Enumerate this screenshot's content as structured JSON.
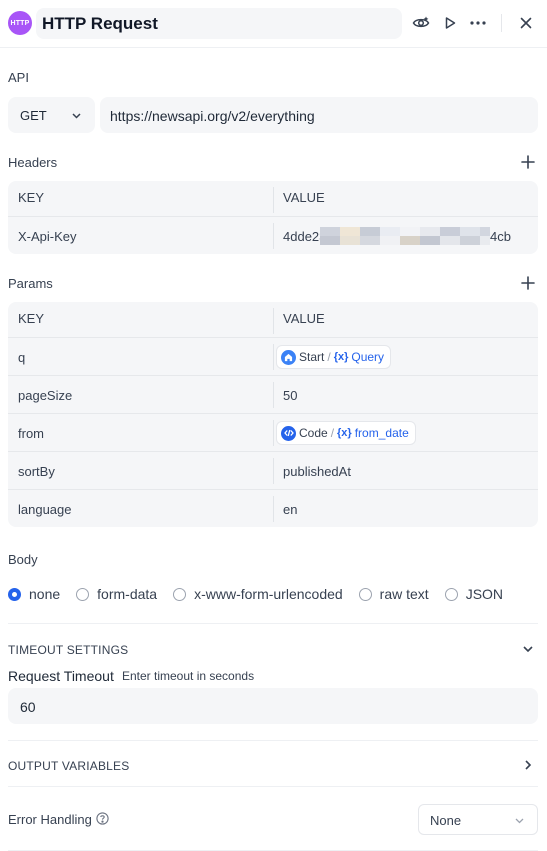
{
  "header": {
    "icon_text": "HTTP",
    "title": "HTTP Request",
    "icon_color": "#a855f7"
  },
  "api": {
    "label": "API",
    "method": "GET",
    "url": "https://newsapi.org/v2/everything"
  },
  "headers": {
    "label": "Headers",
    "columns": {
      "key": "KEY",
      "value": "VALUE"
    },
    "rows": [
      {
        "key": "X-Api-Key",
        "value_prefix": "4dde23",
        "value_suffix": "4cb"
      }
    ]
  },
  "params": {
    "label": "Params",
    "columns": {
      "key": "KEY",
      "value": "VALUE"
    },
    "rows": [
      {
        "key": "q",
        "chip": {
          "node": "Start",
          "separator": "/",
          "var_symbol": "{x}",
          "var": "Query"
        }
      },
      {
        "key": "pageSize",
        "value": "50"
      },
      {
        "key": "from",
        "chip": {
          "node": "Code",
          "separator": "/",
          "var_symbol": "{x}",
          "var": "from_date"
        }
      },
      {
        "key": "sortBy",
        "value": "publishedAt"
      },
      {
        "key": "language",
        "value": "en"
      }
    ]
  },
  "body": {
    "label": "Body",
    "options": [
      "none",
      "form-data",
      "x-www-form-urlencoded",
      "raw text",
      "JSON"
    ],
    "selected": "none"
  },
  "timeout": {
    "section_label": "TIMEOUT SETTINGS",
    "field_label": "Request Timeout",
    "placeholder": "Enter timeout in seconds",
    "value": "60"
  },
  "output": {
    "label": "OUTPUT VARIABLES"
  },
  "error_handling": {
    "label": "Error Handling",
    "value": "None"
  },
  "colors": {
    "accent": "#2563eb",
    "field_bg": "#f5f6f8"
  }
}
